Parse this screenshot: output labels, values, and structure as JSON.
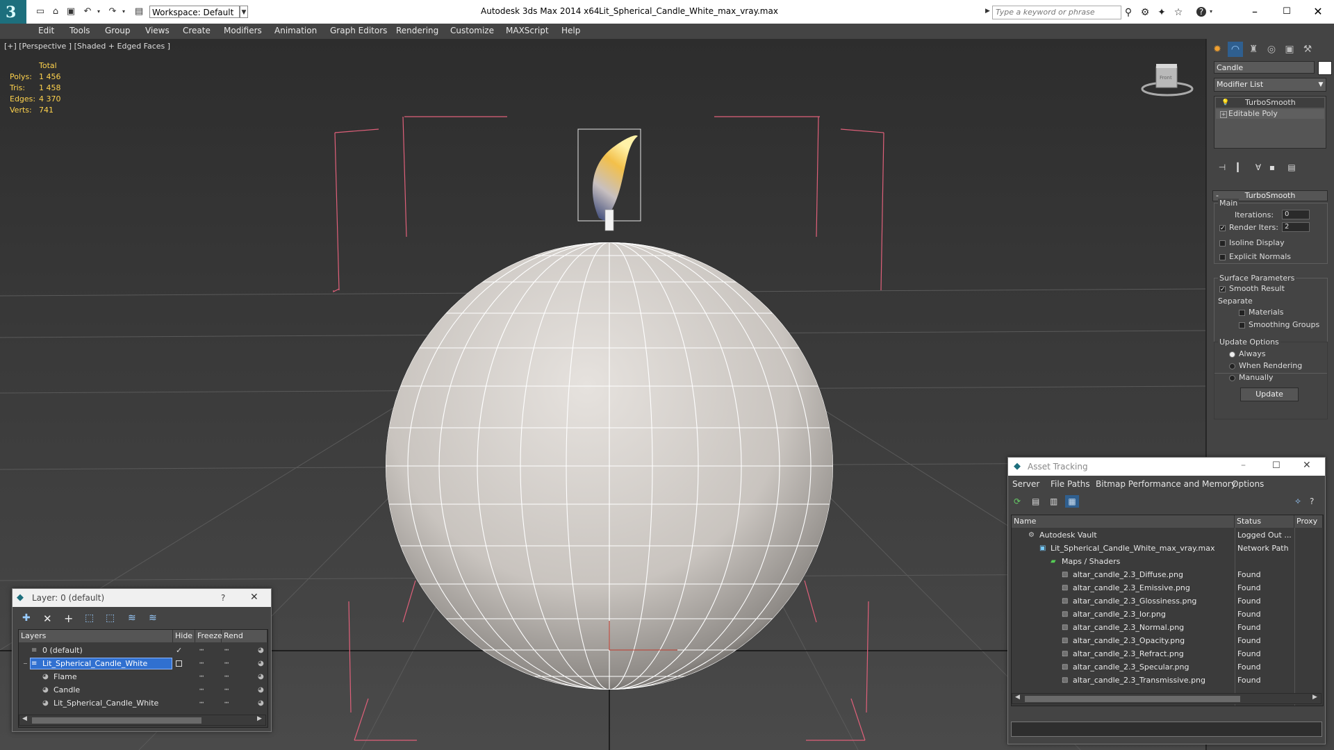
{
  "app": {
    "title": "Autodesk 3ds Max  2014 x64",
    "file": "Lit_Spherical_Candle_White_max_vray.max",
    "workspace": "Workspace: Default",
    "search_placeholder": "Type a keyword or phrase"
  },
  "menu": [
    "Edit",
    "Tools",
    "Group",
    "Views",
    "Create",
    "Modifiers",
    "Animation",
    "Graph Editors",
    "Rendering",
    "Customize",
    "MAXScript",
    "Help"
  ],
  "viewport": {
    "label": "[+] [Perspective ] [Shaded + Edged Faces ]",
    "stats": {
      "header": "Total",
      "rows": [
        {
          "label": "Polys:",
          "value": "1 456"
        },
        {
          "label": "Tris:",
          "value": "1 458"
        },
        {
          "label": "Edges:",
          "value": "4 370"
        },
        {
          "label": "Verts:",
          "value": "741"
        }
      ]
    },
    "viewcube_label": "Front"
  },
  "command_panel": {
    "object_name": "Candle",
    "object_color": "#ffffff",
    "modifier_list": "Modifier List",
    "stack": [
      "TurboSmooth",
      "Editable Poly"
    ],
    "rollout_title": "TurboSmooth",
    "main_label": "Main",
    "iterations_label": "Iterations:",
    "iterations_value": "0",
    "render_iters_label": "Render Iters:",
    "render_iters_value": "2",
    "isoline_label": "Isoline Display",
    "explicit_normals_label": "Explicit Normals",
    "surface_params_label": "Surface Parameters",
    "smooth_result_label": "Smooth Result",
    "separate_label": "Separate",
    "materials_label": "Materials",
    "smoothing_groups_label": "Smoothing Groups",
    "update_options_label": "Update Options",
    "always_label": "Always",
    "when_rendering_label": "When Rendering",
    "manually_label": "Manually",
    "update_button": "Update"
  },
  "layer_dialog": {
    "title": "Layer: 0 (default)",
    "help": "?",
    "columns": [
      "Layers",
      "Hide",
      "Freeze",
      "Rend"
    ],
    "rows": [
      {
        "name": "0 (default)"
      },
      {
        "name": "Lit_Spherical_Candle_White"
      },
      {
        "name": "Flame"
      },
      {
        "name": "Candle"
      },
      {
        "name": "Lit_Spherical_Candle_White"
      }
    ]
  },
  "asset_dialog": {
    "title": "Asset Tracking",
    "menu": [
      "Server",
      "File",
      "Paths",
      "Bitmap Performance and Memory",
      "Options"
    ],
    "columns": [
      "Name",
      "Status",
      "Proxy"
    ],
    "rows": [
      {
        "name": "Autodesk Vault",
        "status": "Logged Out ..."
      },
      {
        "name": "Lit_Spherical_Candle_White_max_vray.max",
        "status": "Network Path"
      },
      {
        "name": "Maps / Shaders",
        "status": ""
      },
      {
        "name": "altar_candle_2.3_Diffuse.png",
        "status": "Found"
      },
      {
        "name": "altar_candle_2.3_Emissive.png",
        "status": "Found"
      },
      {
        "name": "altar_candle_2.3_Glossiness.png",
        "status": "Found"
      },
      {
        "name": "altar_candle_2.3_Ior.png",
        "status": "Found"
      },
      {
        "name": "altar_candle_2.3_Normal.png",
        "status": "Found"
      },
      {
        "name": "altar_candle_2.3_Opacity.png",
        "status": "Found"
      },
      {
        "name": "altar_candle_2.3_Refract.png",
        "status": "Found"
      },
      {
        "name": "altar_candle_2.3_Specular.png",
        "status": "Found"
      },
      {
        "name": "altar_candle_2.3_Transmissive.png",
        "status": "Found"
      }
    ]
  },
  "colors": {
    "accent": "#1d6f7d",
    "selection": "#3070d0",
    "stat_text": "#ffd34d",
    "bracket": "#e0607a"
  }
}
